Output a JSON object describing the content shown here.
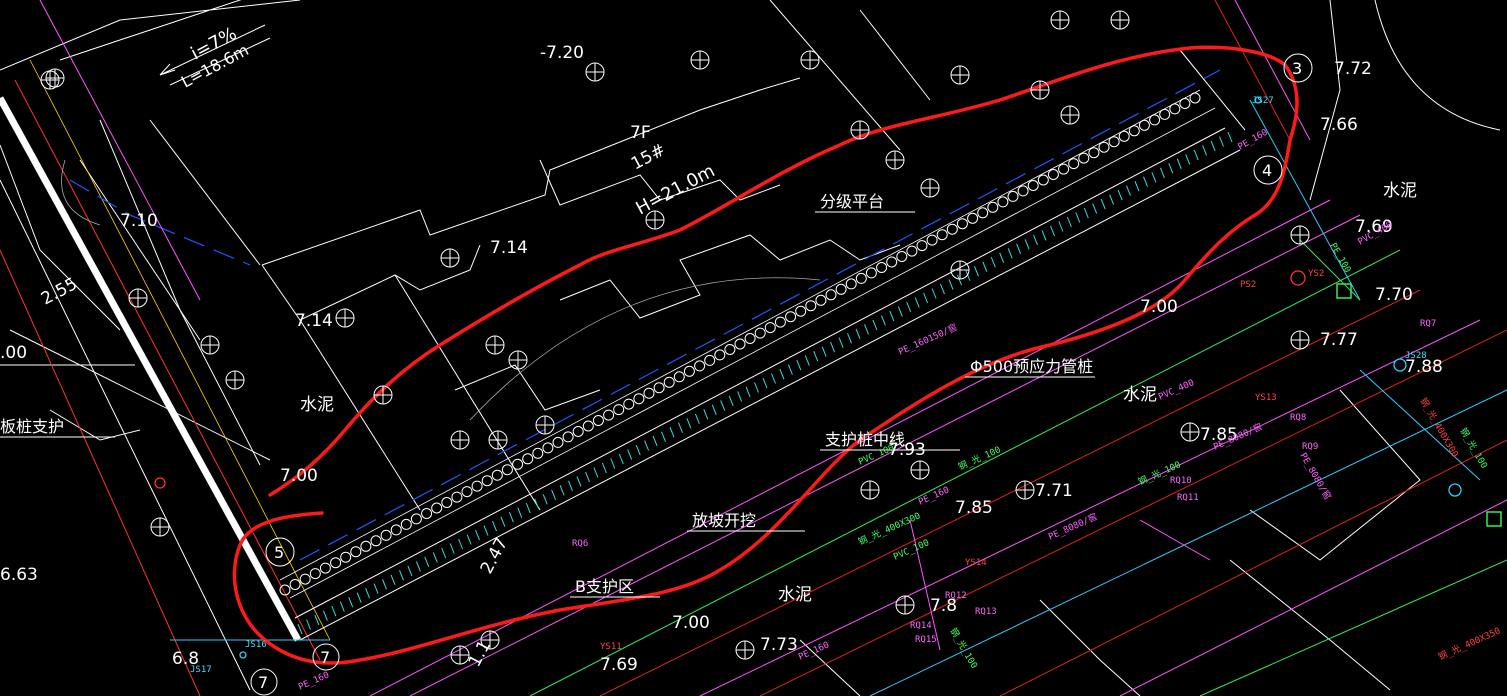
{
  "labels": {
    "slope_i": "i=7%",
    "slope_l": "L=18.6m",
    "elev_720": "-7.20",
    "elev_772": "7.72",
    "elev_766": "7.66",
    "elev_710": "7.10",
    "elev_714": "7.14",
    "elev_714b": "7.14",
    "elev_769": "7.69",
    "elev_770": "7.70",
    "elev_777": "7.77",
    "elev_788": "7.88",
    "elev_785": "7.85",
    "elev_793": "7.93",
    "elev_785b": "7.85",
    "elev_771": "7.71",
    "elev_773": "7.73",
    "elev_769b": "7.69",
    "elev_700a": "7.00",
    "elev_700b": "7.00",
    "elev_700c": "7.00",
    "elev_700d": ".00",
    "elev_663": "6.63",
    "elev_68": "6.8",
    "elev_7b": "7.8",
    "dim_255": "2.55",
    "dim_247": "2.47",
    "dim_11": "1.1",
    "floors": "7F",
    "bldg_no": "15#",
    "height": "H=21.0m",
    "platform": "分级平台",
    "pile": "Φ500预应力管桩",
    "axis": "支护桩中线",
    "slope_cut": "放坡开挖",
    "zone_b": "B支护区",
    "cement1": "水泥",
    "cement2": "水泥",
    "cement3": "水泥",
    "cement4": "水泥",
    "sheet_pile": "板桩支护",
    "c3": "3",
    "c4": "4",
    "c5": "5",
    "c7": "7",
    "c7b": "7",
    "pipe1": "PE_160150/窖",
    "pipe2": "PVC_400",
    "pipe3": "PE_8080/窖",
    "pipe4": "PE_8080/窖",
    "pipe5": "PE_100",
    "pipe6": "PVC_400",
    "pipe7": "PE_160",
    "pipe8": "钢_光_400X300",
    "pipe9": "钢_光_400X300",
    "pipe10": "钢_光_100",
    "pipe11": "钢_光_100",
    "pipe12": "PE_8080/窖",
    "pipe13": "PE_160",
    "pipe14": "钢_光_400X350",
    "pipe15": "PE_160",
    "pipe16": "钢_光_100",
    "pipe17": "PVC_100",
    "pipe18": "PE_160",
    "pipe19": "钢_光_100",
    "pipe20": "PVC_100",
    "tag_js27": "JS27",
    "tag_ys2": "YS2",
    "tag_rq7": "RQ7",
    "tag_js28": "JS28",
    "tag_ys13": "YS13",
    "tag_rq8": "RQ8",
    "tag_rq9": "RQ9",
    "tag_rq10": "RQ10",
    "tag_rq11": "RQ11",
    "tag_ys14": "YS14",
    "tag_rq12": "RQ12",
    "tag_rq13": "RQ13",
    "tag_rq14": "RQ14",
    "tag_rq15": "RQ15",
    "tag_rq6": "RQ6",
    "tag_ys11": "YS11",
    "tag_js16": "JS16",
    "tag_js17": "JS17",
    "tag_ps2": "PS2"
  },
  "colors": {
    "background": "#000000",
    "linework": "#ffffff",
    "markup": "#ff1a1a",
    "pipe_magenta": "#ff55ff",
    "pipe_green": "#33ee55",
    "pipe_cyan": "#33ccff",
    "pipe_red": "#dd2222",
    "boundary_blue": "#2255ff"
  }
}
